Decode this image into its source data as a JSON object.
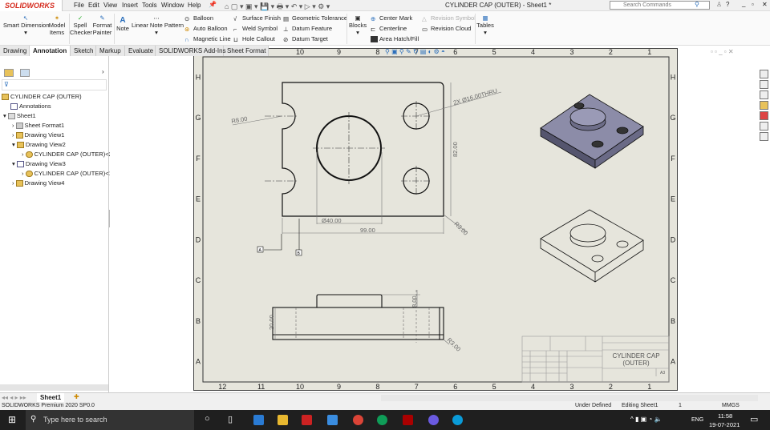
{
  "app": {
    "logo": "SOLIDWORKS",
    "title": "CYLINDER CAP (OUTER) - Sheet1 *",
    "search_placeholder": "Search Commands"
  },
  "menu": [
    "File",
    "Edit",
    "View",
    "Insert",
    "Tools",
    "Window",
    "Help"
  ],
  "ribbon": {
    "smart_dimension": "Smart Dimension",
    "model_items": [
      "Model",
      "Items"
    ],
    "spell_checker": [
      "Spell",
      "Checker"
    ],
    "format_painter": [
      "Format",
      "Painter"
    ],
    "note": "Note",
    "linear_note_pattern": "Linear Note Pattern",
    "balloon": "Balloon",
    "auto_balloon": "Auto Balloon",
    "magnetic_line": "Magnetic Line",
    "surface_finish": "Surface Finish",
    "weld_symbol": "Weld Symbol",
    "hole_callout": "Hole Callout",
    "geometric_tolerance": "Geometric Tolerance",
    "datum_feature": "Datum Feature",
    "datum_target": "Datum Target",
    "blocks": "Blocks",
    "center_mark": "Center Mark",
    "centerline": "Centerline",
    "area_hatch": "Area Hatch/Fill",
    "revision_symbol": "Revision Symbol",
    "revision_cloud": "Revision Cloud",
    "tables": "Tables"
  },
  "tabs": [
    "Drawing",
    "Annotation",
    "Sketch",
    "Markup",
    "Evaluate",
    "SOLIDWORKS Add-Ins",
    "Sheet Format"
  ],
  "active_tab": "Annotation",
  "tree": [
    "CYLINDER CAP (OUTER)",
    "Annotations",
    "Sheet1",
    "Sheet Format1",
    "Drawing View1",
    "Drawing View2",
    "CYLINDER CAP (OUTER)<2",
    "Drawing View3",
    "CYLINDER CAP (OUTER)<1",
    "Drawing View4"
  ],
  "zones_cols": [
    "12",
    "11",
    "10",
    "9",
    "8",
    "7",
    "6",
    "5",
    "4",
    "3",
    "2",
    "1"
  ],
  "zones_rows": [
    "H",
    "G",
    "F",
    "E",
    "D",
    "C",
    "B",
    "A"
  ],
  "dimensions": {
    "r8": "R8.00",
    "holes": "2X Ø16.00THRU",
    "d40": "Ø40.00",
    "w99": "99.00",
    "h82": "82.00",
    "r3": "R3.00",
    "h20": "20.00",
    "h8": "8.00",
    "r3b": "R3.00",
    "datum_a": "A",
    "datum_b": "B"
  },
  "title_block": {
    "title": [
      "CYLINDER CAP",
      "(OUTER)"
    ],
    "size": "A3"
  },
  "sheet_tab": "Sheet1",
  "status": {
    "product": "SOLIDWORKS Premium 2020 SP0.0",
    "state": "Under Defined",
    "editing": "Editing Sheet1",
    "units": "MMGS",
    "scale": "1"
  },
  "taskbar": {
    "search": "Type here to search",
    "lang": "ENG",
    "time": "11:58",
    "date": "19-07-2021"
  }
}
